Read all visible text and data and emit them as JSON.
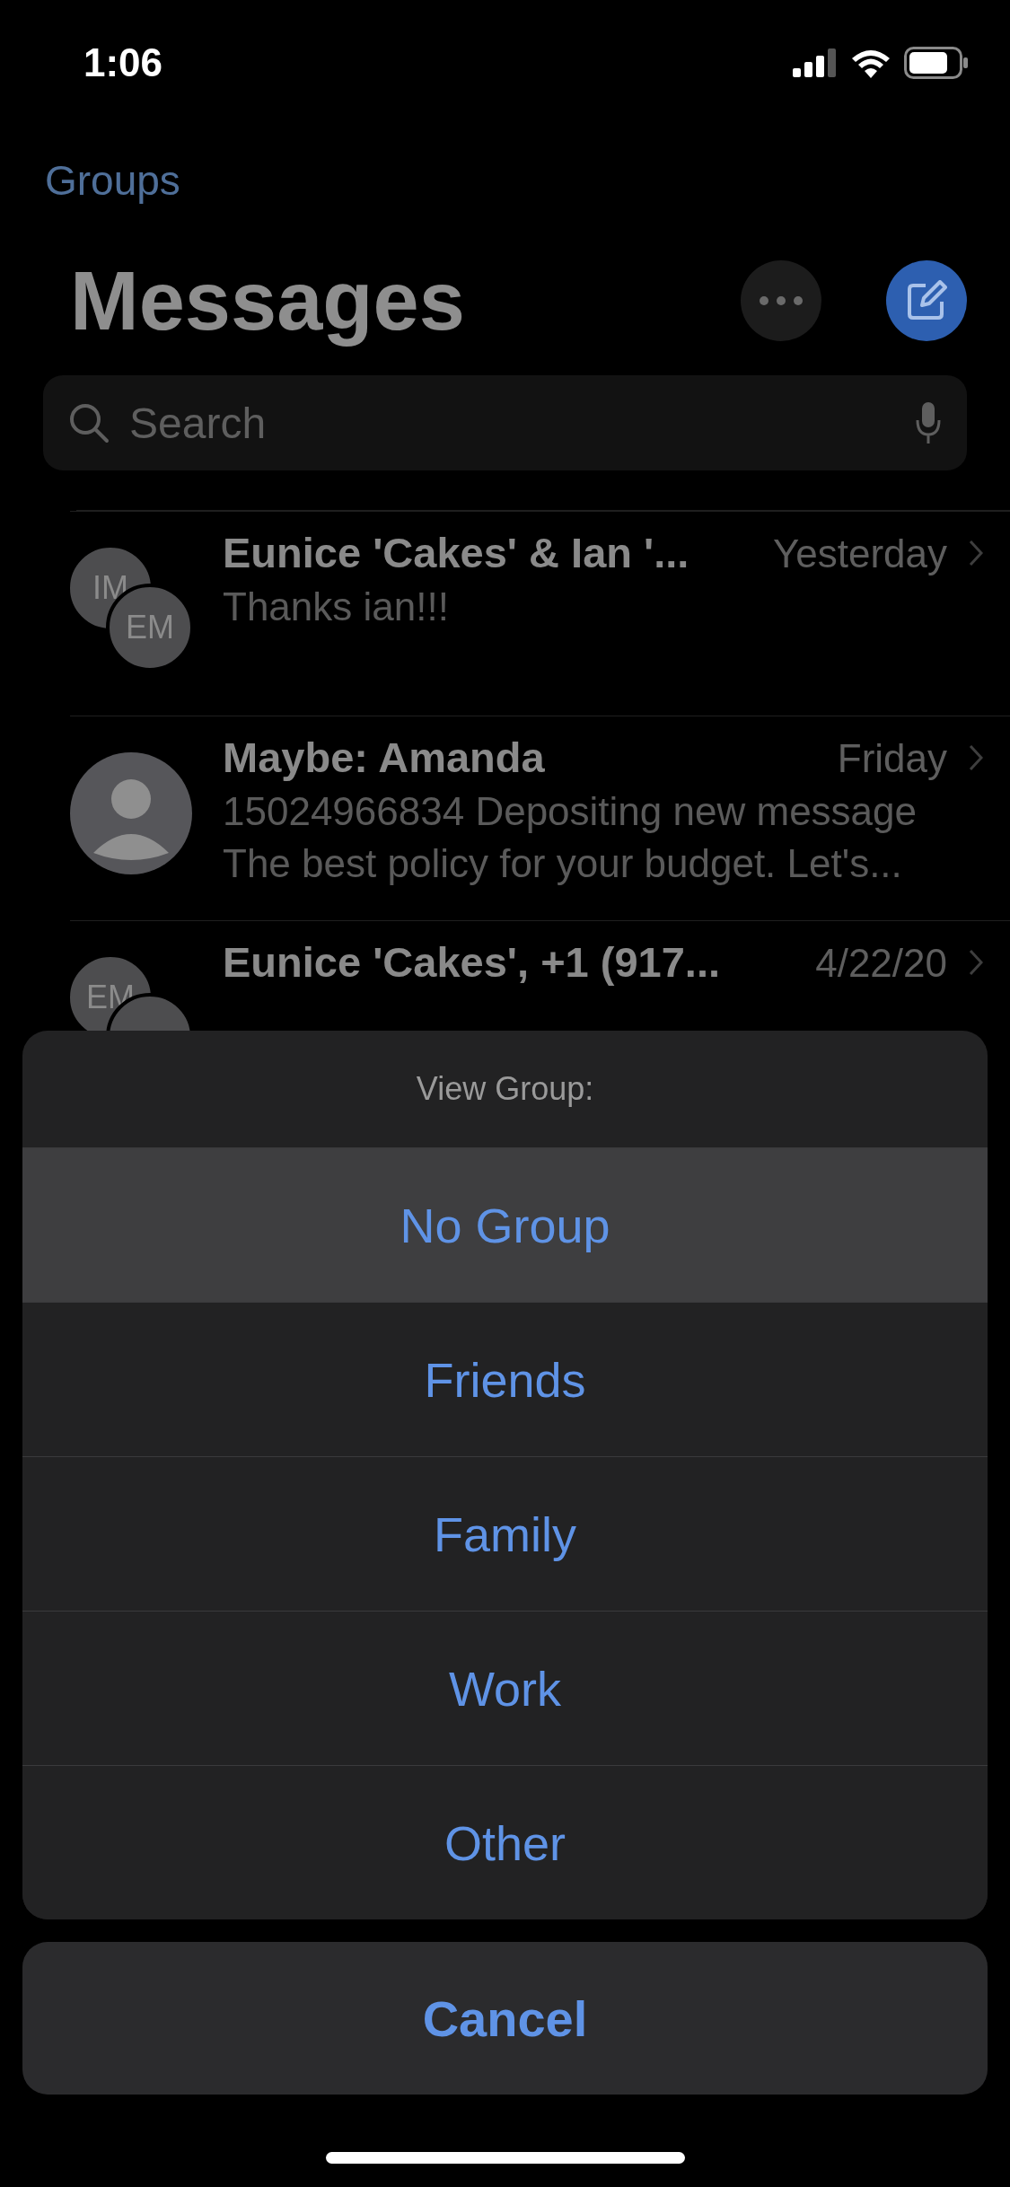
{
  "status_bar": {
    "time": "1:06"
  },
  "nav": {
    "back": "Groups",
    "title": "Messages"
  },
  "search": {
    "placeholder": "Search"
  },
  "conversations": [
    {
      "name": "Eunice 'Cakes' & Ian '...",
      "time": "Yesterday",
      "preview": [
        "Thanks ian!!!"
      ],
      "avatar": {
        "kind": "pair",
        "initials": [
          "IM",
          "EM"
        ]
      }
    },
    {
      "name": "Maybe: Amanda",
      "time": "Friday",
      "preview": [
        "15024966834 Depositing new message",
        "The best policy for your budget. Let's..."
      ],
      "avatar": {
        "kind": "person"
      }
    },
    {
      "name": "Eunice 'Cakes', +1 (917...",
      "time": "4/22/20",
      "avatar": {
        "kind": "pair",
        "initials": [
          "EM"
        ]
      }
    }
  ],
  "action_sheet": {
    "title": "View Group:",
    "options": [
      {
        "label": "No Group",
        "selected": true
      },
      {
        "label": "Friends",
        "selected": false
      },
      {
        "label": "Family",
        "selected": false
      },
      {
        "label": "Work",
        "selected": false
      },
      {
        "label": "Other",
        "selected": false
      }
    ],
    "cancel": "Cancel"
  }
}
